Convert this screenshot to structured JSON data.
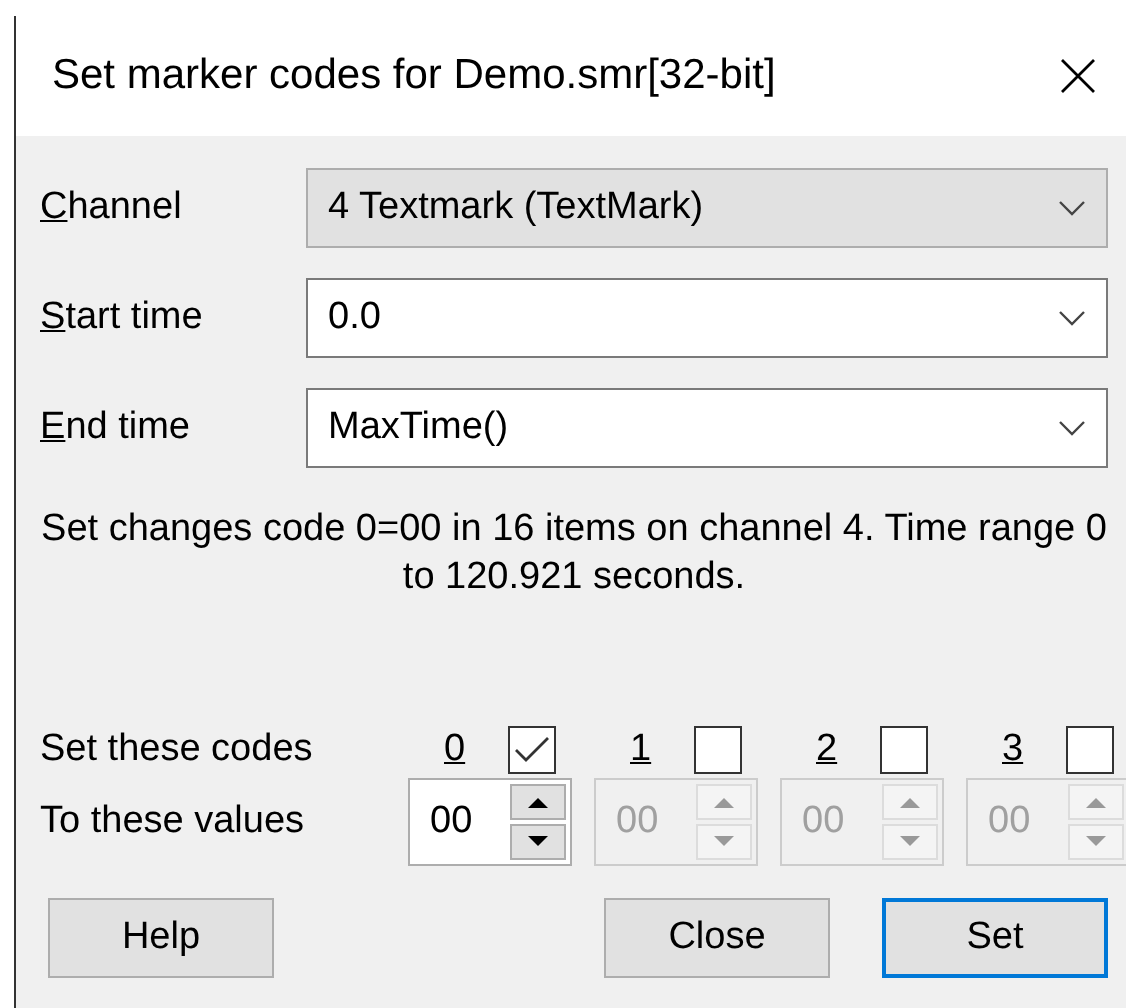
{
  "window": {
    "title": "Set marker codes for Demo.smr[32-bit]"
  },
  "fields": [
    {
      "label": "Channel",
      "value": "4 Textmark (TextMark)",
      "disabled": true
    },
    {
      "label": "Start time",
      "value": "0.0",
      "disabled": false
    },
    {
      "label": "End time",
      "value": "MaxTime()",
      "disabled": false
    }
  ],
  "info": "Set changes code 0=00 in 16 items on channel 4. Time range 0 to 120.921 seconds.",
  "codes_label": "Set these codes",
  "values_label": "To these values",
  "codes": [
    {
      "label": "0",
      "checked": true,
      "value": "00"
    },
    {
      "label": "1",
      "checked": false,
      "value": "00"
    },
    {
      "label": "2",
      "checked": false,
      "value": "00"
    },
    {
      "label": "3",
      "checked": false,
      "value": "00"
    }
  ],
  "buttons": [
    {
      "label": "Help",
      "default": false
    },
    {
      "label": "Close",
      "default": false
    },
    {
      "label": "Set",
      "default": true
    }
  ]
}
